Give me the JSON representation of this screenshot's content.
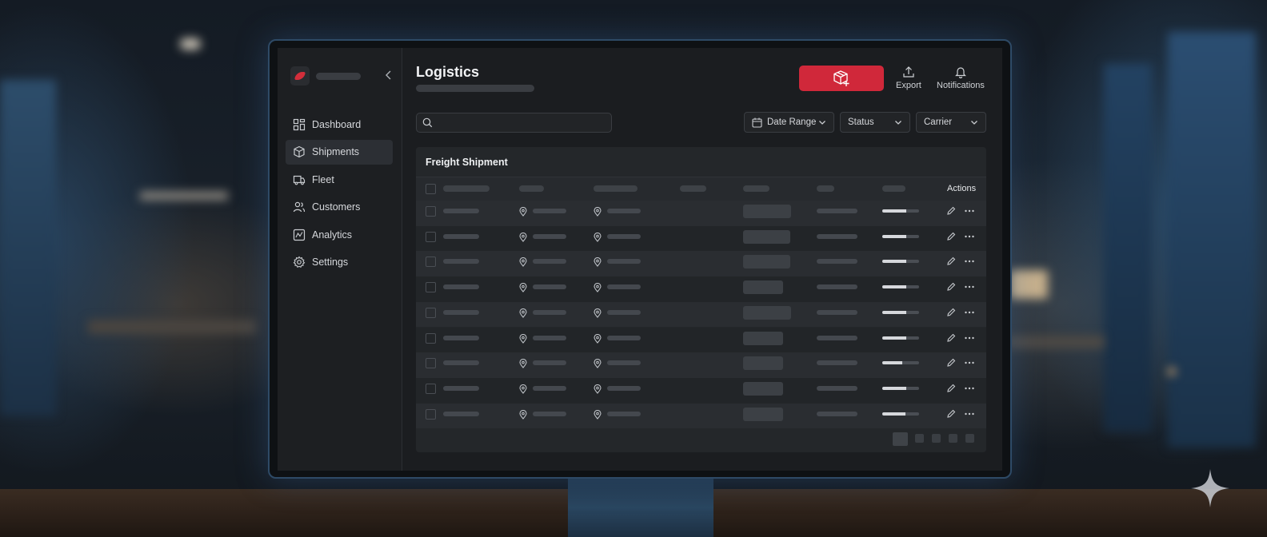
{
  "app": {
    "title": "Logistics",
    "accent_color": "#d0283a"
  },
  "sidebar": {
    "collapse_icon": "chevron-left-icon",
    "items": [
      {
        "label": "Dashboard",
        "icon": "dashboard-icon",
        "active": false
      },
      {
        "label": "Shipments",
        "icon": "package-icon",
        "active": true
      },
      {
        "label": "Fleet",
        "icon": "truck-icon",
        "active": false
      },
      {
        "label": "Customers",
        "icon": "users-icon",
        "active": false
      },
      {
        "label": "Analytics",
        "icon": "analytics-icon",
        "active": false
      },
      {
        "label": "Settings",
        "icon": "gear-icon",
        "active": false
      }
    ]
  },
  "toolbar": {
    "primary_icon": "add-package-icon",
    "export_label": "Export",
    "notifications_label": "Notifications"
  },
  "filters": {
    "search_placeholder": "",
    "date_range_label": "Date Range",
    "status_label": "Status",
    "carrier_label": "Carrier"
  },
  "table": {
    "title": "Freight Shipment",
    "actions_header": "Actions",
    "rows": [
      {
        "progress": 0.65
      },
      {
        "progress": 0.65
      },
      {
        "progress": 0.65
      },
      {
        "progress": 0.65
      },
      {
        "progress": 0.65
      },
      {
        "progress": 0.65
      },
      {
        "progress": 0.55
      },
      {
        "progress": 0.65
      },
      {
        "progress": 0.62
      }
    ]
  }
}
